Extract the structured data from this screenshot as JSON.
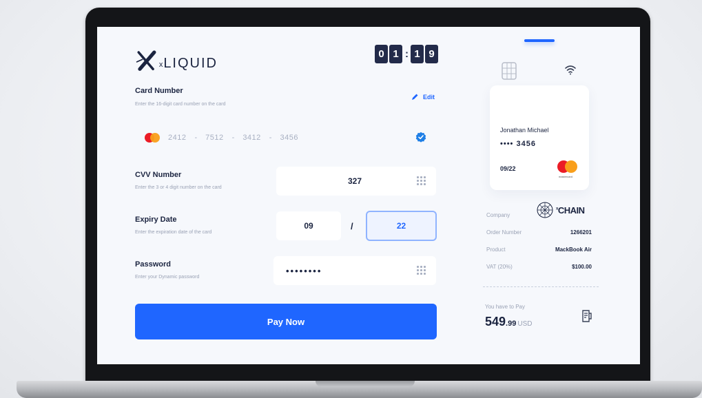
{
  "brand": {
    "name": "LIQUID",
    "prefix": "x"
  },
  "timer": {
    "minutes": [
      "0",
      "1"
    ],
    "seconds": [
      "1",
      "9"
    ]
  },
  "form": {
    "card_number": {
      "title": "Card Number",
      "subtitle": "Enter the 16-digit card number on the card",
      "edit_label": "Edit",
      "groups": [
        "2412",
        "7512",
        "3412",
        "3456"
      ],
      "separator": "-"
    },
    "cvv": {
      "title": "CVV Number",
      "subtitle": "Enter the 3 or 4 digit number on the card",
      "value": "327"
    },
    "expiry": {
      "title": "Expiry Date",
      "subtitle": "Enter the expiration date of the card",
      "month": "09",
      "slash": "/",
      "year": "22"
    },
    "password": {
      "title": "Password",
      "subtitle": "Enter your Dynamic password",
      "value": "••••••••"
    },
    "pay_button": "Pay Now"
  },
  "card_preview": {
    "holder": "Jonathan Michael",
    "masked_number": "•••• 3456",
    "expiry": "09/22",
    "network_label": "mastercard"
  },
  "order": {
    "company_label": "Company",
    "company_value": "CHAIN",
    "company_sup": "x",
    "rows": [
      {
        "label": "Order Number",
        "value": "1266201"
      },
      {
        "label": "Product",
        "value": "MackBook Air"
      },
      {
        "label": "VAT (20%)",
        "value": "$100.00"
      }
    ],
    "total_label": "You have to Pay",
    "total_main": "549",
    "total_cents": ".99",
    "total_currency": "USD"
  },
  "colors": {
    "accent": "#1f66ff",
    "navy": "#1b2440",
    "mastercard_red": "#eb1c26",
    "mastercard_orange": "#f99f1b"
  },
  "icons": [
    "edit-pencil-icon",
    "verified-check-icon",
    "keypad-grid-icon",
    "chip-icon",
    "contactless-icon",
    "receipt-icon",
    "mastercard-logo"
  ]
}
